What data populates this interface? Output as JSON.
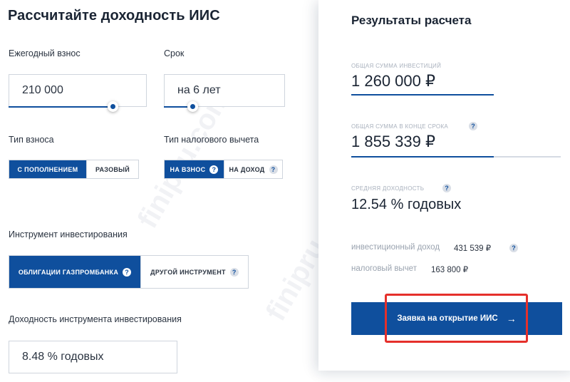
{
  "page_title": "Рассчитайте доходность ИИС",
  "contribution": {
    "label": "Ежегодный взнос",
    "value": "210 000"
  },
  "term": {
    "label": "Срок",
    "value": "на 6 лет"
  },
  "contribution_type": {
    "label": "Тип взноса",
    "options": [
      "С ПОПОЛНЕНИЕМ",
      "РАЗОВЫЙ"
    ],
    "selected": "С ПОПОЛНЕНИЕМ"
  },
  "tax_deduction_type": {
    "label": "Тип налогового вычета",
    "options": [
      "НА ВЗНОС",
      "НА ДОХОД"
    ],
    "selected": "НА ВЗНОС",
    "help": "?"
  },
  "instrument": {
    "label": "Инструмент инвестирования",
    "options": [
      "ОБЛИГАЦИИ ГАЗПРОМБАНКА",
      "ДРУГОЙ ИНСТРУМЕНТ"
    ],
    "selected": "ОБЛИГАЦИИ ГАЗПРОМБАНКА",
    "help": "?"
  },
  "instrument_yield": {
    "label": "Доходность инструмента инвестирования",
    "value": "8.48 % годовых"
  },
  "results": {
    "title": "Результаты расчета",
    "total_investment": {
      "label": "ОБЩАЯ СУММА ИНВЕСТИЦИЙ",
      "value": "1 260 000 ₽"
    },
    "total_end": {
      "label": "ОБЩАЯ СУММА В КОНЦЕ СРОКА",
      "value": "1 855 339 ₽",
      "help": "?"
    },
    "avg_yield": {
      "label": "СРЕДНЯЯ ДОХОДНОСТЬ",
      "value": "12.54 % годовых",
      "help": "?"
    },
    "investment_income": {
      "label": "инвестиционный доход",
      "value": "431 539 ₽",
      "help": "?"
    },
    "tax_deduction": {
      "label": "налоговый вычет",
      "value": "163 800 ₽"
    }
  },
  "cta": {
    "label": "Заявка на открытие ИИС",
    "arrow": "→"
  },
  "watermark": "finipru.com",
  "colors": {
    "accent": "#0f4f9d",
    "highlight": "#e5302b"
  }
}
